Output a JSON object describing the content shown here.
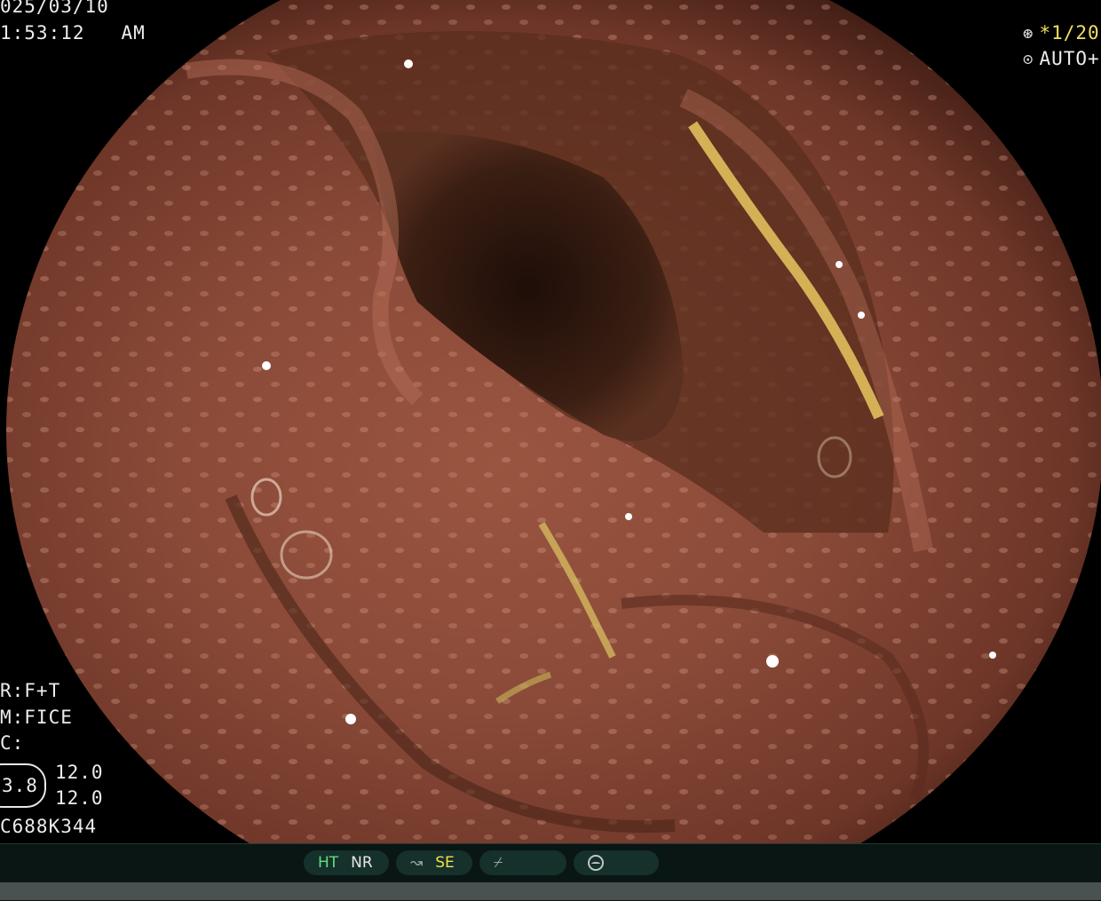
{
  "overlay_top_left": {
    "date": "025/03/10",
    "time": "1:53:12",
    "ampm": "AM"
  },
  "overlay_top_right": {
    "shutter_icon": "shutter-icon",
    "shutter_value": "*1/20",
    "iris_icon": "iris-icon",
    "iris_value": "AUTO+"
  },
  "overlay_bottom_left": {
    "line1": "R:F+T",
    "line2": "M:FICE",
    "line3": "C:",
    "badge_value": "3.8",
    "value_top": "12.0",
    "value_bottom": "12.0",
    "scope_id": "C688K344"
  },
  "status_bar": {
    "group1": {
      "ht": "HT",
      "nr": "NR"
    },
    "group2": {
      "se_icon": "structure-enhance-icon",
      "se": "SE"
    },
    "group3": {
      "icon": "color-mode-icon"
    },
    "group4": {
      "icon": "record-icon"
    }
  },
  "colors": {
    "mucosa": "#8a4a3a",
    "lumen": "#2a140c",
    "status_active": "#5fe07a",
    "status_highlight": "#f2e04a"
  }
}
